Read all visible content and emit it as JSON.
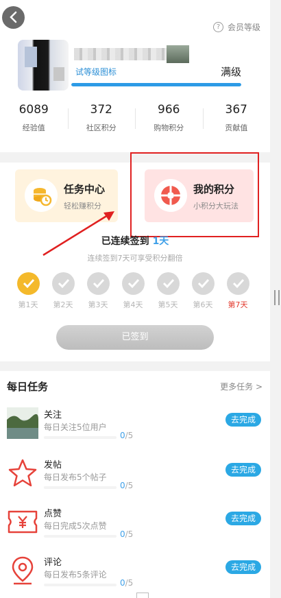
{
  "header": {
    "help_icon": "question-circle-icon",
    "help_label": "会员等级"
  },
  "profile": {
    "level_icon_text": "试等级图标",
    "level_status": "满级",
    "level_progress_percent": 100
  },
  "stats": [
    {
      "value": "6089",
      "label": "经验值"
    },
    {
      "value": "372",
      "label": "社区积分"
    },
    {
      "value": "966",
      "label": "购物积分"
    },
    {
      "value": "367",
      "label": "贡献值"
    }
  ],
  "tiles": {
    "task_center": {
      "title": "任务中心",
      "subtitle": "轻松赚积分",
      "icon": "coins-icon"
    },
    "my_points": {
      "title": "我的积分",
      "subtitle": "小积分大玩法",
      "icon": "gift-wheel-icon"
    }
  },
  "checkin": {
    "title_prefix": "已连续签到",
    "title_days": "1天",
    "subtitle": "连续签到7天可享受积分翻倍",
    "days": [
      {
        "label": "第1天",
        "done": true
      },
      {
        "label": "第2天",
        "done": false
      },
      {
        "label": "第3天",
        "done": false
      },
      {
        "label": "第4天",
        "done": false
      },
      {
        "label": "第5天",
        "done": false
      },
      {
        "label": "第6天",
        "done": false
      },
      {
        "label": "第7天",
        "done": false
      }
    ],
    "button_label": "已签到"
  },
  "daily_tasks": {
    "title": "每日任务",
    "more_label": "更多任务 >",
    "items": [
      {
        "name": "关注",
        "desc": "每日关注5位用户",
        "done": "0",
        "total": "/5",
        "button": "去完成",
        "icon": "landscape-thumbnail"
      },
      {
        "name": "发帖",
        "desc": "每日发布5个帖子",
        "done": "0",
        "total": "/5",
        "button": "去完成",
        "icon": "star-outline-icon"
      },
      {
        "name": "点赞",
        "desc": "每日完成5次点赞",
        "done": "0",
        "total": "/5",
        "button": "去完成",
        "icon": "yen-ticket-icon"
      },
      {
        "name": "评论",
        "desc": "每日发布5条评论",
        "done": "0",
        "total": "/5",
        "button": "去完成",
        "icon": "location-pin-icon"
      }
    ]
  },
  "colors": {
    "accent_blue": "#2ba8e4",
    "checkin_gold": "#f4b92b",
    "annotation_red": "#e02020"
  }
}
